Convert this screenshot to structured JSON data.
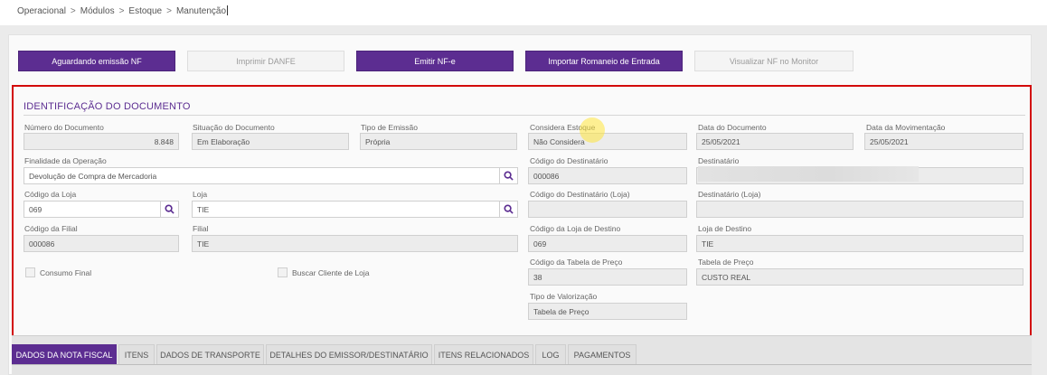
{
  "breadcrumb": [
    "Operacional",
    "Módulos",
    "Estoque",
    "Manutenção"
  ],
  "breadcrumb_separator": ">",
  "toolbar": {
    "aguardando": "Aguardando emissão NF",
    "imprimir": "Imprimir DANFE",
    "emitir": "Emitir NF-e",
    "importar": "Importar Romaneio de Entrada",
    "visualizar": "Visualizar NF no Monitor"
  },
  "section": {
    "title": "IDENTIFICAÇÃO DO DOCUMENTO"
  },
  "form": {
    "numero_documento": {
      "label": "Número do Documento",
      "value": "8.848"
    },
    "situacao_documento": {
      "label": "Situação do Documento",
      "value": "Em Elaboração"
    },
    "tipo_emissao": {
      "label": "Tipo de Emissão",
      "value": "Própria"
    },
    "considera_estoque": {
      "label": "Considera Estoque",
      "value": "Não Considera"
    },
    "data_documento": {
      "label": "Data do Documento",
      "value": "25/05/2021"
    },
    "data_movimentacao": {
      "label": "Data da Movimentação",
      "value": "25/05/2021"
    },
    "finalidade_operacao": {
      "label": "Finalidade da Operação",
      "value": "Devolução de Compra de Mercadoria"
    },
    "codigo_destinatario": {
      "label": "Código do Destinatário",
      "value": "000086"
    },
    "destinatario": {
      "label": "Destinatário",
      "value": ""
    },
    "codigo_loja": {
      "label": "Código da Loja",
      "value": "069"
    },
    "loja": {
      "label": "Loja",
      "value": "TIE"
    },
    "codigo_destinatario_loja": {
      "label": "Código do Destinatário (Loja)",
      "value": ""
    },
    "destinatario_loja": {
      "label": "Destinatário (Loja)",
      "value": ""
    },
    "codigo_filial": {
      "label": "Código da Filial",
      "value": "000086"
    },
    "filial": {
      "label": "Filial",
      "value": "TIE"
    },
    "codigo_loja_destino": {
      "label": "Código da Loja de Destino",
      "value": "069"
    },
    "loja_destino": {
      "label": "Loja de Destino",
      "value": "TIE"
    },
    "consumo_final": {
      "label": "Consumo Final"
    },
    "buscar_cliente_loja": {
      "label": "Buscar Cliente de Loja"
    },
    "codigo_tabela_preco": {
      "label": "Código da Tabela de Preço",
      "value": "38"
    },
    "tabela_preco": {
      "label": "Tabela de Preço",
      "value": "CUSTO REAL"
    },
    "tipo_valorizacao": {
      "label": "Tipo de Valorização",
      "value": "Tabela de Preço"
    }
  },
  "tabs": [
    {
      "label": "DADOS DA NOTA FISCAL",
      "active": true
    },
    {
      "label": "ITENS"
    },
    {
      "label": "DADOS DE TRANSPORTE"
    },
    {
      "label": "DETALHES DO EMISSOR/DESTINATÁRIO"
    },
    {
      "label": "ITENS RELACIONADOS"
    },
    {
      "label": "LOG"
    },
    {
      "label": "PAGAMENTOS"
    }
  ],
  "icons": {
    "search": "search-icon",
    "checkbox": "checkbox"
  },
  "colors": {
    "primary": "#5c2d91",
    "highlight": "#d20a0a"
  }
}
